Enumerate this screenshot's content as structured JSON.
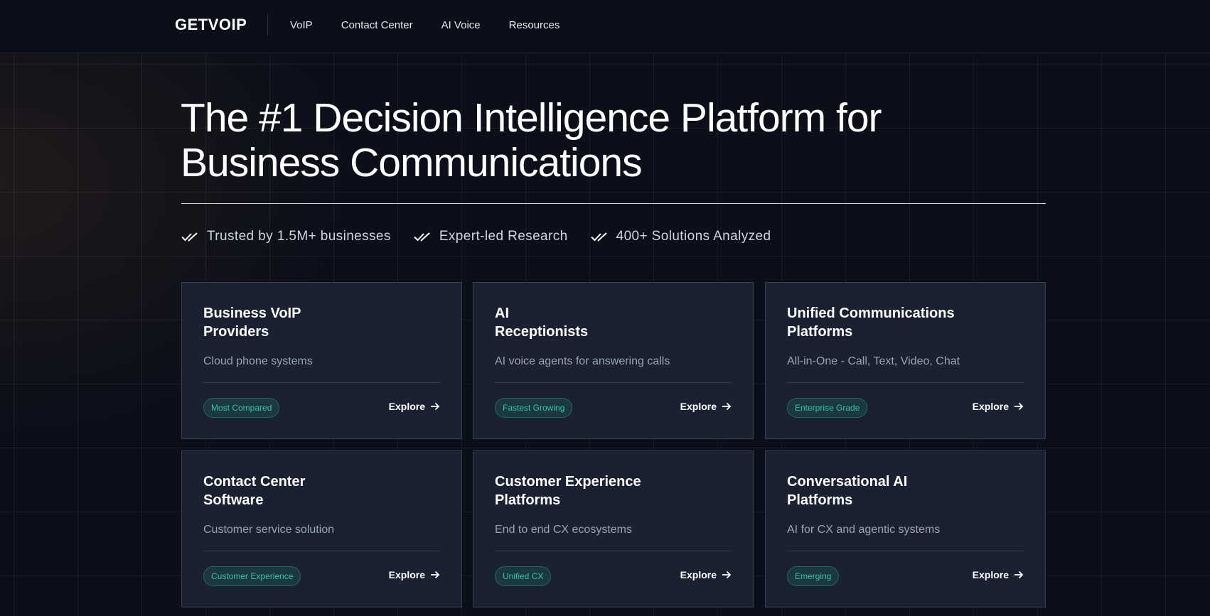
{
  "header": {
    "logo": "GETVOIP",
    "nav": [
      "VoIP",
      "Contact Center",
      "AI Voice",
      "Resources"
    ]
  },
  "hero": {
    "title_line1": "The #1 Decision Intelligence Platform for",
    "title_line2": "Business Communications",
    "trust": [
      "Trusted by 1.5M+ businesses",
      "Expert-led Research",
      "400+ Solutions Analyzed"
    ]
  },
  "cards": [
    {
      "title_line1": "Business VoIP",
      "title_line2": "Providers",
      "desc": "Cloud phone systems",
      "badge": "Most Compared",
      "cta": "Explore"
    },
    {
      "title_line1": "AI",
      "title_line2": "Receptionists",
      "desc": "AI voice agents for answering calls",
      "badge": "Fastest Growing",
      "cta": "Explore"
    },
    {
      "title_line1": "Unified Communications",
      "title_line2": "Platforms",
      "desc": "All-in-One - Call, Text, Video, Chat",
      "badge": "Enterprise Grade",
      "cta": "Explore"
    },
    {
      "title_line1": "Contact Center",
      "title_line2": "Software",
      "desc": "Customer service solution",
      "badge": "Customer Experience",
      "cta": "Explore"
    },
    {
      "title_line1": "Customer Experience",
      "title_line2": "Platforms",
      "desc": "End to end CX ecosystems",
      "badge": "Unified CX",
      "cta": "Explore"
    },
    {
      "title_line1": "Conversational AI",
      "title_line2": "Platforms",
      "desc": "AI for CX and agentic systems",
      "badge": "Emerging",
      "cta": "Explore"
    }
  ],
  "colors": {
    "background": "#0b0f1a",
    "card": "#1a2232",
    "badge_text": "#35c2a6"
  }
}
